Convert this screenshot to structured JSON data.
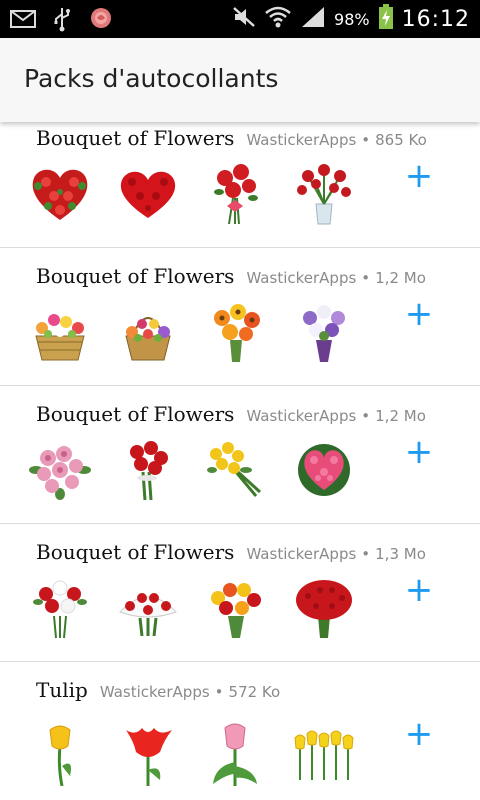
{
  "status_bar": {
    "left_icons": [
      "mail-icon",
      "usb-icon",
      "rose-notification-icon"
    ],
    "right_icons": [
      "mute-icon",
      "wifi-icon",
      "signal-icon",
      "battery-charging-icon"
    ],
    "battery": "98%",
    "time": "16:12"
  },
  "app_bar": {
    "title": "Packs d'autocollants"
  },
  "packs": [
    {
      "name": "Bouquet of Flowers",
      "publisher": "WastickerApps",
      "size": "865 Ko",
      "stickers": [
        "heart-roses-icon",
        "heart-red-flowers-icon",
        "red-rose-bouquet-icon",
        "roses-in-vase-icon"
      ]
    },
    {
      "name": "Bouquet of Flowers",
      "publisher": "WastickerApps",
      "size": "1,2 Mo",
      "stickers": [
        "flower-basket-icon",
        "flower-basket-icon",
        "orange-gerbera-bouquet-icon",
        "purple-bouquet-icon"
      ]
    },
    {
      "name": "Bouquet of Flowers",
      "publisher": "WastickerApps",
      "size": "1,2 Mo",
      "stickers": [
        "pink-roses-bouquet-icon",
        "red-roses-bouquet-icon",
        "yellow-roses-bouquet-icon",
        "pink-heart-bouquet-icon"
      ]
    },
    {
      "name": "Bouquet of Flowers",
      "publisher": "WastickerApps",
      "size": "1,3 Mo",
      "stickers": [
        "red-white-bouquet-icon",
        "red-white-roses-icon",
        "yellow-red-roses-icon",
        "red-roses-dome-icon"
      ]
    },
    {
      "name": "Tulip",
      "publisher": "WastickerApps",
      "size": "572 Ko",
      "stickers": [
        "yellow-tulip-icon",
        "red-tulip-icon",
        "pink-tulip-icon",
        "yellow-tulips-row-icon"
      ]
    }
  ],
  "add_label": "+",
  "meta_separator": "•",
  "colors": {
    "accent": "#1e9bf0",
    "status_bar": "#000000",
    "app_bar": "#f7f7f7"
  }
}
